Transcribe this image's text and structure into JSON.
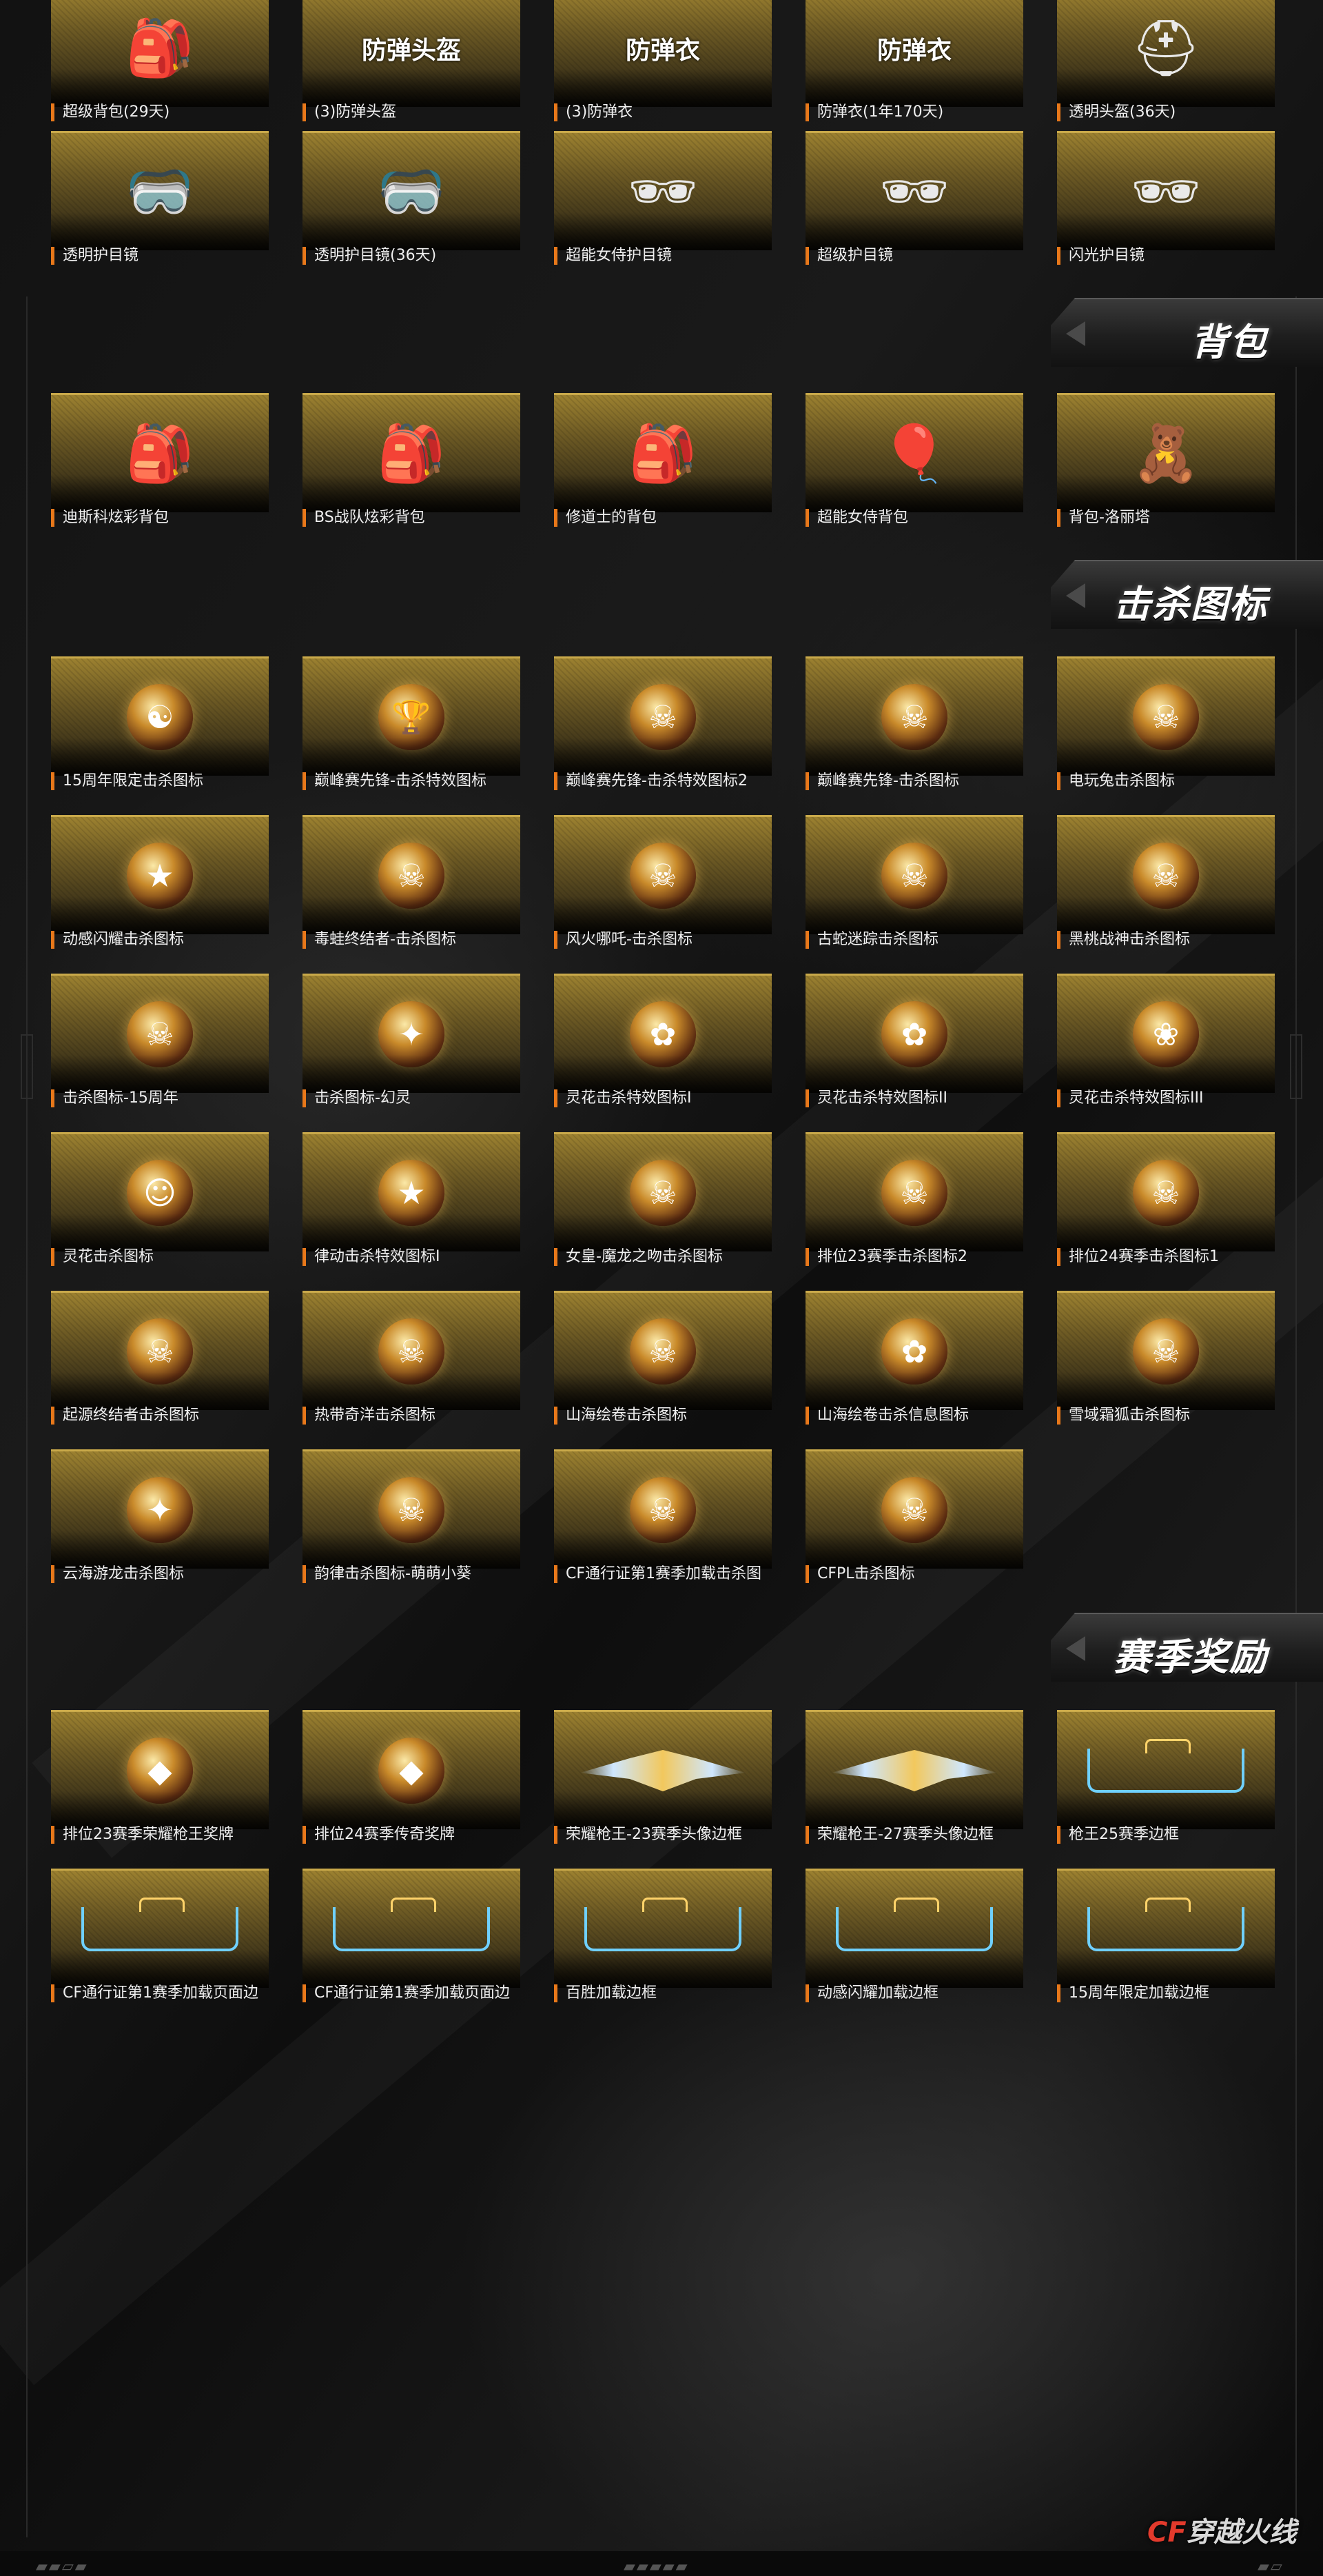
{
  "colors": {
    "accent": "#e8781a",
    "tile_gold": "#9c8130",
    "background": "#0b0b0b"
  },
  "rows": [
    {
      "top": "row0",
      "items": [
        {
          "label": "超级背包(29天)",
          "icon": "backpack-icon",
          "glyph": "🎒",
          "title": ""
        },
        {
          "label": "(3)防弹头盔",
          "icon": "helmet-icon",
          "glyph": "",
          "title": "防弹头盔"
        },
        {
          "label": "(3)防弹衣",
          "icon": "body-armor-icon",
          "glyph": "",
          "title": "防弹衣"
        },
        {
          "label": "防弹衣(1年170天)",
          "icon": "body-armor-icon",
          "glyph": "",
          "title": "防弹衣"
        },
        {
          "label": "透明头盔(36天)",
          "icon": "helmet-icon",
          "glyph": "⛑",
          "title": ""
        }
      ]
    },
    {
      "top": "row1",
      "items": [
        {
          "label": "透明护目镜",
          "icon": "goggles-icon",
          "glyph": "🥽",
          "title": ""
        },
        {
          "label": "透明护目镜(36天)",
          "icon": "goggles-icon",
          "glyph": "🥽",
          "title": ""
        },
        {
          "label": "超能女侍护目镜",
          "icon": "goggles-icon",
          "glyph": "🕶",
          "title": ""
        },
        {
          "label": "超级护目镜",
          "icon": "goggles-icon",
          "glyph": "🕶",
          "title": ""
        },
        {
          "label": "闪光护目镜",
          "icon": "goggles-icon",
          "glyph": "🕶",
          "title": ""
        }
      ]
    }
  ],
  "sections": {
    "backpack": {
      "title": "背包"
    },
    "kill_icons": {
      "title": "击杀图标"
    },
    "season_rewards": {
      "title": "赛季奖励"
    }
  },
  "backpack_items": [
    {
      "label": "迪斯科炫彩背包",
      "glyph": "🎒"
    },
    {
      "label": "BS战队炫彩背包",
      "glyph": "🎒"
    },
    {
      "label": "修道士的背包",
      "glyph": "🎒"
    },
    {
      "label": "超能女侍背包",
      "glyph": "🎈"
    },
    {
      "label": "背包-洛丽塔",
      "glyph": "🧸"
    }
  ],
  "kill_icon_items": [
    {
      "label": "15周年限定击杀图标",
      "glyph": "☯"
    },
    {
      "label": "巅峰赛先锋-击杀特效图标",
      "glyph": "🏆"
    },
    {
      "label": "巅峰赛先锋-击杀特效图标2",
      "glyph": "☠"
    },
    {
      "label": "巅峰赛先锋-击杀图标",
      "glyph": "☠"
    },
    {
      "label": "电玩兔击杀图标",
      "glyph": "☠"
    },
    {
      "label": "动感闪耀击杀图标",
      "glyph": "★"
    },
    {
      "label": "毒蛙终结者-击杀图标",
      "glyph": "☠"
    },
    {
      "label": "风火哪吒-击杀图标",
      "glyph": "☠"
    },
    {
      "label": "古蛇迷踪击杀图标",
      "glyph": "☠"
    },
    {
      "label": "黑桃战神击杀图标",
      "glyph": "☠"
    },
    {
      "label": "击杀图标-15周年",
      "glyph": "☠"
    },
    {
      "label": "击杀图标-幻灵",
      "glyph": "✦"
    },
    {
      "label": "灵花击杀特效图标I",
      "glyph": "✿"
    },
    {
      "label": "灵花击杀特效图标II",
      "glyph": "✿"
    },
    {
      "label": "灵花击杀特效图标III",
      "glyph": "❀"
    },
    {
      "label": "灵花击杀图标",
      "glyph": "☺"
    },
    {
      "label": "律动击杀特效图标I",
      "glyph": "★"
    },
    {
      "label": "女皇-魔龙之吻击杀图标",
      "glyph": "☠"
    },
    {
      "label": "排位23赛季击杀图标2",
      "glyph": "☠"
    },
    {
      "label": "排位24赛季击杀图标1",
      "glyph": "☠"
    },
    {
      "label": "起源终结者击杀图标",
      "glyph": "☠"
    },
    {
      "label": "热带奇洋击杀图标",
      "glyph": "☠"
    },
    {
      "label": "山海绘卷击杀图标",
      "glyph": "☠"
    },
    {
      "label": "山海绘卷击杀信息图标",
      "glyph": "✿"
    },
    {
      "label": "雪域霜狐击杀图标",
      "glyph": "☠"
    },
    {
      "label": "云海游龙击杀图标",
      "glyph": "✦"
    },
    {
      "label": "韵律击杀图标-萌萌小葵",
      "glyph": "☠"
    },
    {
      "label": "CF通行证第1赛季加载击杀图",
      "glyph": "☠"
    },
    {
      "label": "CFPL击杀图标",
      "glyph": "☠"
    }
  ],
  "season_items": [
    {
      "label": "排位23赛季荣耀枪王奖牌",
      "kind": "emblem",
      "glyph": "◆"
    },
    {
      "label": "排位24赛季传奇奖牌",
      "kind": "emblem",
      "glyph": "◆"
    },
    {
      "label": "荣耀枪王-23赛季头像边框",
      "kind": "wing",
      "glyph": ""
    },
    {
      "label": "荣耀枪王-27赛季头像边框",
      "kind": "wing",
      "glyph": ""
    },
    {
      "label": "枪王25赛季边框",
      "kind": "frame",
      "glyph": ""
    },
    {
      "label": "CF通行证第1赛季加载页面边",
      "kind": "frame",
      "glyph": ""
    },
    {
      "label": "CF通行证第1赛季加载页面边",
      "kind": "frame",
      "glyph": ""
    },
    {
      "label": "百胜加载边框",
      "kind": "frame",
      "glyph": ""
    },
    {
      "label": "动感闪耀加载边框",
      "kind": "frame",
      "glyph": ""
    },
    {
      "label": "15周年限定加载边框",
      "kind": "frame",
      "glyph": ""
    }
  ],
  "footer": {
    "logo_cf": "CF",
    "logo_text": "穿越火线"
  }
}
